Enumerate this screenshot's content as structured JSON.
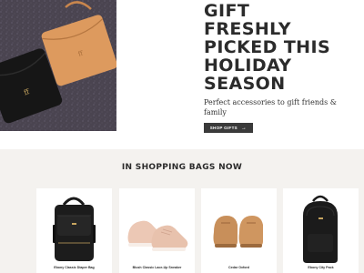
{
  "hero": {
    "title": "GIFT\nFRESHLY\nPICKED THIS\nHOLIDAY\nSEASON",
    "subtitle": "Perfect accessories to gift friends & family",
    "cta_label": "SHOP GIFTS",
    "cta_arrow": "→"
  },
  "section": {
    "title": "IN SHOPPING BAGS NOW"
  },
  "products": [
    {
      "name": "Ebony Classic Diaper Bag"
    },
    {
      "name": "Blush Classic Lace-Up Sneaker"
    },
    {
      "name": "Cedar Oxford"
    },
    {
      "name": "Ebony City Pack"
    }
  ],
  "colors": {
    "dark_text": "#2b2b2b",
    "cta_bg": "#3a3a3a",
    "section_bg": "#f4f2ef",
    "black_leather": "#1a1a1a",
    "tan_leather": "#d9975c",
    "blush": "#ecc8b5",
    "cedar": "#c88f5a"
  }
}
